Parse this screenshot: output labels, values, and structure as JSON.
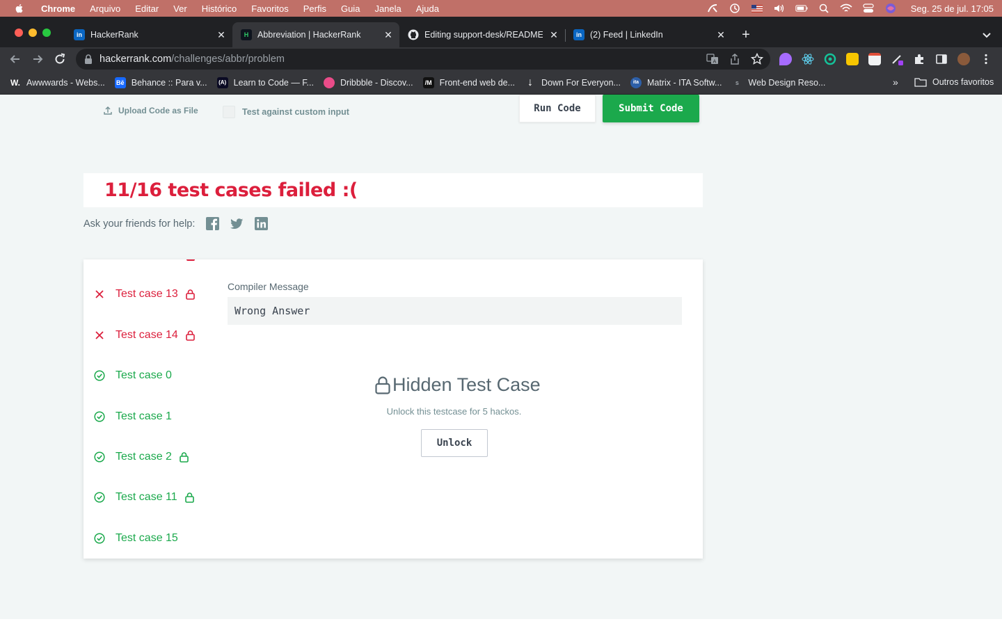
{
  "menubar": {
    "items": [
      "Chrome",
      "Arquivo",
      "Editar",
      "Ver",
      "Histórico",
      "Favoritos",
      "Perfis",
      "Guia",
      "Janela",
      "Ajuda"
    ],
    "datetime": "Seg. 25 de jul.  17:05"
  },
  "tabs": [
    {
      "title": "HackerRank",
      "favicon": "linkedin-icon",
      "active": false
    },
    {
      "title": "Abbreviation | HackerRank",
      "favicon": "hackerrank-icon",
      "active": true
    },
    {
      "title": "Editing support-desk/README",
      "favicon": "github-icon",
      "active": false
    },
    {
      "title": "(2) Feed | LinkedIn",
      "favicon": "linkedin-icon",
      "active": false
    }
  ],
  "omnibox": {
    "domain": "hackerrank.com",
    "path": "/challenges/abbr/problem"
  },
  "bookmarks": [
    {
      "label": "Awwwards - Webs...",
      "icon": "W.",
      "color": "#222222"
    },
    {
      "label": "Behance :: Para v...",
      "icon": "Bē",
      "color": "#1769ff"
    },
    {
      "label": "Learn to Code — F...",
      "icon": "(A)",
      "color": "#0a0a23"
    },
    {
      "label": "Dribbble - Discov...",
      "icon": "",
      "color": "#ea4c89"
    },
    {
      "label": "Front-end web de...",
      "icon": "/M",
      "color": "#111111"
    },
    {
      "label": "Down For Everyon...",
      "icon": "↓",
      "color": "#35363a"
    },
    {
      "label": "Matrix - ITA Softw...",
      "icon": "ita",
      "color": "#2d5fa8"
    },
    {
      "label": "Web Design Reso...",
      "icon": "s",
      "color": "#35363a"
    }
  ],
  "bookmarks_more": "»",
  "bookmarks_other": "Outros favoritos",
  "editor": {
    "upload_label": "Upload Code as File",
    "custom_input_label": "Test against custom input",
    "run_label": "Run Code",
    "submit_label": "Submit Code"
  },
  "result": {
    "heading": "11/16 test cases failed :(",
    "share_label": "Ask your friends for help:"
  },
  "testcases": [
    {
      "label": "Test case 13",
      "status": "fail",
      "locked": true
    },
    {
      "label": "Test case 14",
      "status": "fail",
      "locked": true
    },
    {
      "label": "Test case 0",
      "status": "pass",
      "locked": false
    },
    {
      "label": "Test case 1",
      "status": "pass",
      "locked": false
    },
    {
      "label": "Test case 2",
      "status": "pass",
      "locked": true
    },
    {
      "label": "Test case 11",
      "status": "pass",
      "locked": true
    },
    {
      "label": "Test case 15",
      "status": "pass",
      "locked": false
    }
  ],
  "details": {
    "compiler_label": "Compiler Message",
    "compiler_message": "Wrong Answer",
    "hidden_title": "Hidden Test Case",
    "hidden_sub": "Unlock this testcase for 5 hackos.",
    "unlock_label": "Unlock"
  },
  "colors": {
    "fail": "#dc1f3c",
    "pass": "#1ba94c",
    "submit": "#1ba94c",
    "menubar": "#c07068"
  }
}
